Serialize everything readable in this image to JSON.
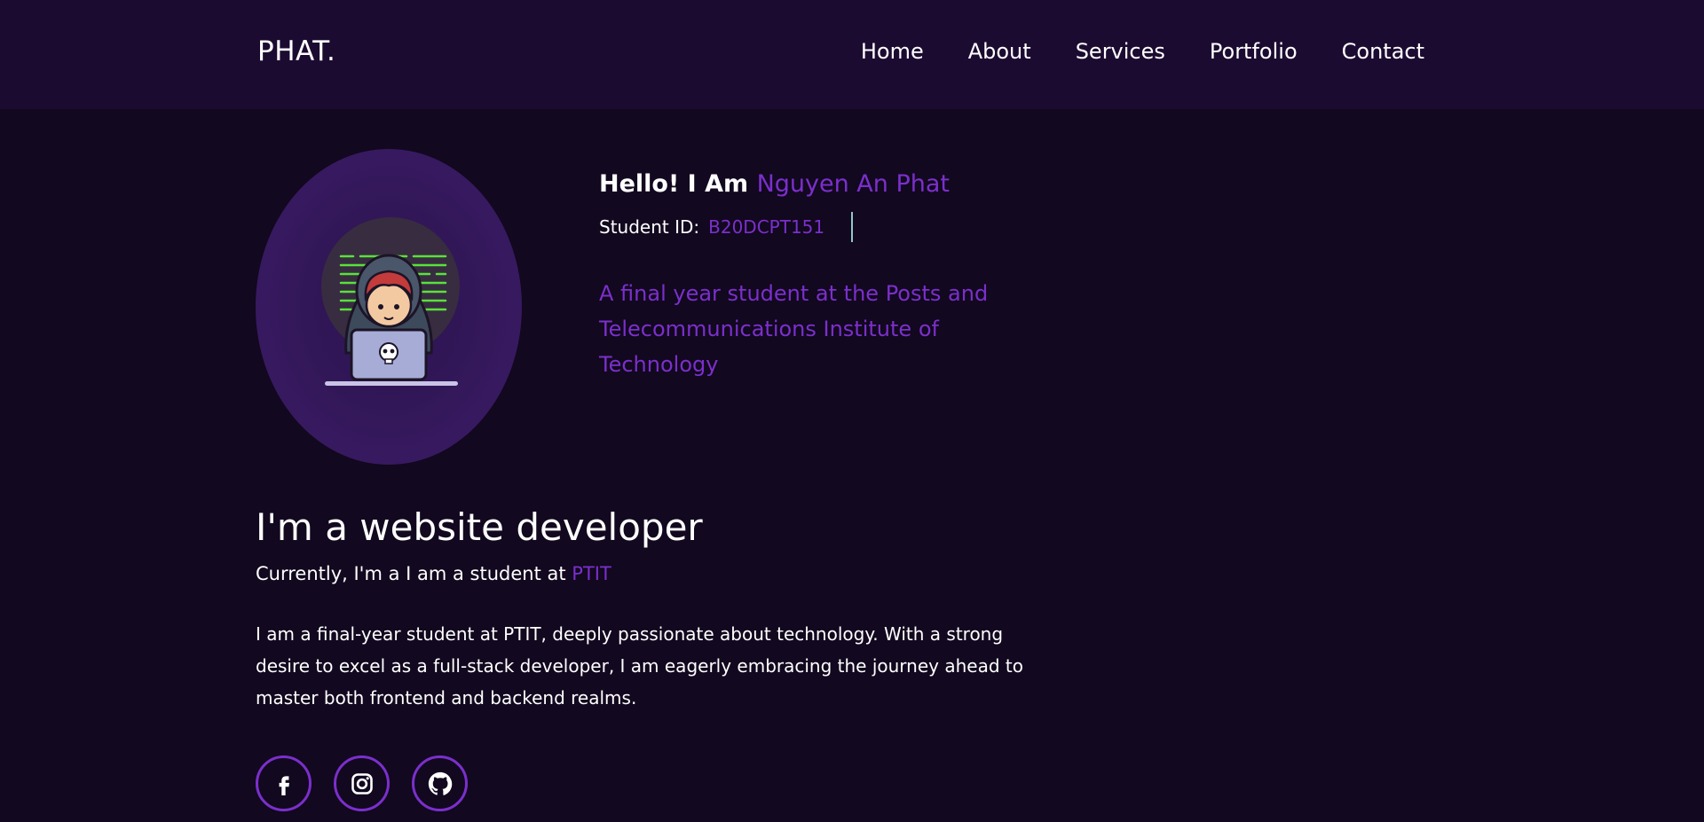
{
  "nav": {
    "logo": "PHAT.",
    "links": [
      "Home",
      "About",
      "Services",
      "Portfolio",
      "Contact"
    ]
  },
  "hero": {
    "greeting": "Hello! I Am",
    "name": "Nguyen An Phat",
    "student_id_label": "Student ID:",
    "student_id": "B20DCPT151",
    "tagline": "A final year student at the Posts and Telecommunications Institute of Technology",
    "avatar_icon": "hacker-illustration"
  },
  "about": {
    "headline": "I'm a website developer",
    "current_prefix": "Currently, I'm a I am a student at",
    "current_school": "PTIT",
    "bio": "I am a final-year student at PTIT, deeply passionate about technology. With a strong desire to excel as a full-stack developer, I am eagerly embracing the journey ahead to master both frontend and backend realms."
  },
  "socials": [
    {
      "icon": "facebook-icon"
    },
    {
      "icon": "instagram-icon"
    },
    {
      "icon": "github-icon"
    }
  ],
  "colors": {
    "background": "#12081f",
    "navbar": "#1c0b31",
    "accent": "#7b2fcc",
    "text": "#ffffff"
  }
}
